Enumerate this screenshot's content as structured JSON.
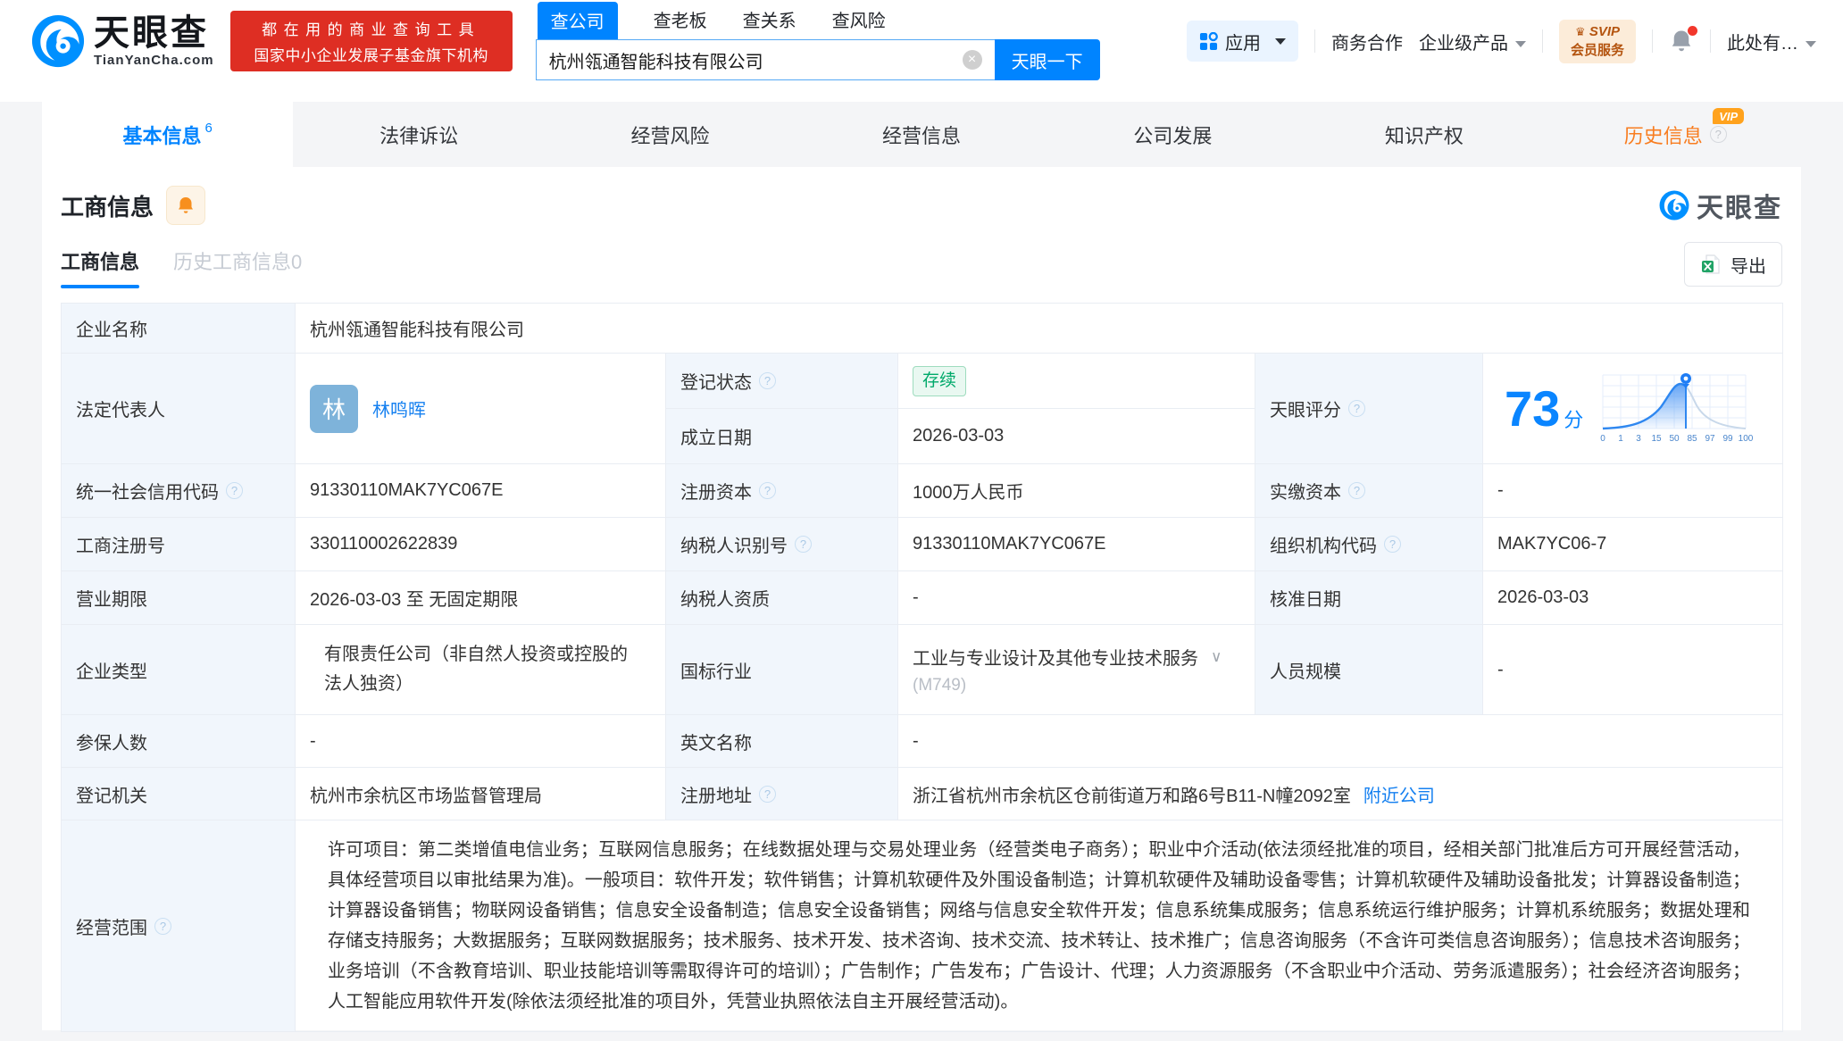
{
  "header": {
    "logo": {
      "brand": "天眼查",
      "domain": "TianYanCha.com"
    },
    "slogan_line1": "都在用的商业查询工具",
    "slogan_line2": "国家中小企业发展子基金旗下机构",
    "search_tabs": [
      {
        "label": "查公司",
        "active": true
      },
      {
        "label": "查老板",
        "active": false
      },
      {
        "label": "查关系",
        "active": false
      },
      {
        "label": "查风险",
        "active": false
      }
    ],
    "search_value": "杭州瓴通智能科技有限公司",
    "search_button": "天眼一下",
    "apps_label": "应用",
    "menu": [
      "商务合作",
      "企业级产品"
    ],
    "svip_line1": "SVIP",
    "svip_line2": "会员服务",
    "user_label": "此处有…"
  },
  "nav_tabs": [
    {
      "label": "基本信息",
      "count": "6",
      "active": true
    },
    {
      "label": "法律诉讼"
    },
    {
      "label": "经营风险"
    },
    {
      "label": "经营信息"
    },
    {
      "label": "公司发展"
    },
    {
      "label": "知识产权"
    },
    {
      "label": "历史信息",
      "vip_tag": "VIP"
    }
  ],
  "section": {
    "title": "工商信息",
    "watermark": "天眼查",
    "subtabs": [
      {
        "label": "工商信息",
        "active": true
      },
      {
        "label": "历史工商信息0",
        "active": false
      }
    ],
    "export_label": "导出"
  },
  "company": {
    "name_label": "企业名称",
    "name": "杭州瓴通智能科技有限公司",
    "legal_rep_label": "法定代表人",
    "legal_rep_avatar": "林",
    "legal_rep": "林鸣晖",
    "reg_status_label": "登记状态",
    "reg_status": "存续",
    "establish_label": "成立日期",
    "establish_date": "2026-03-03"
  },
  "score": {
    "label": "天眼评分",
    "value": "73",
    "unit": "分",
    "axis": [
      "0",
      "1",
      "3",
      "15",
      "50",
      "85",
      "97",
      "99",
      "100"
    ]
  },
  "fields": {
    "uscc": {
      "label": "统一社会信用代码",
      "value": "91330110MAK7YC067E"
    },
    "reg_capital": {
      "label": "注册资本",
      "value": "1000万人民币"
    },
    "paid_capital": {
      "label": "实缴资本",
      "value": "-"
    },
    "reg_number": {
      "label": "工商注册号",
      "value": "330110002622839"
    },
    "taxpayer_id": {
      "label": "纳税人识别号",
      "value": "91330110MAK7YC067E"
    },
    "org_code": {
      "label": "组织机构代码",
      "value": "MAK7YC06-7"
    },
    "business_term": {
      "label": "营业期限",
      "value": "2026-03-03 至 无固定期限"
    },
    "taxpayer_quality": {
      "label": "纳税人资质",
      "value": "-"
    },
    "approval_date": {
      "label": "核准日期",
      "value": "2026-03-03"
    },
    "company_type": {
      "label": "企业类型",
      "value": "有限责任公司（非自然人投资或控股的法人独资）"
    },
    "industry": {
      "label": "国标行业",
      "value": "工业与专业设计及其他专业技术服务",
      "code": "(M749)"
    },
    "staff_size": {
      "label": "人员规模",
      "value": "-"
    },
    "insured_count": {
      "label": "参保人数",
      "value": "-"
    },
    "english_name": {
      "label": "英文名称",
      "value": "-"
    },
    "reg_authority": {
      "label": "登记机关",
      "value": "杭州市余杭区市场监督管理局"
    },
    "reg_address": {
      "label": "注册地址",
      "value": "浙江省杭州市余杭区仓前街道万和路6号B11-N幢2092室",
      "link": "附近公司"
    },
    "business_scope": {
      "label": "经营范围",
      "value": "许可项目：第二类增值电信业务；互联网信息服务；在线数据处理与交易处理业务（经营类电子商务）；职业中介活动(依法须经批准的项目，经相关部门批准后方可开展经营活动，具体经营项目以审批结果为准)。一般项目：软件开发；软件销售；计算机软硬件及外围设备制造；计算机软硬件及辅助设备零售；计算机软硬件及辅助设备批发；计算器设备制造；计算器设备销售；物联网设备销售；信息安全设备制造；信息安全设备销售；网络与信息安全软件开发；信息系统集成服务；信息系统运行维护服务；计算机系统服务；数据处理和存储支持服务；大数据服务；互联网数据服务；技术服务、技术开发、技术咨询、技术交流、技术转让、技术推广；信息咨询服务（不含许可类信息咨询服务）；信息技术咨询服务；业务培训（不含教育培训、职业技能培训等需取得许可的培训）；广告制作；广告发布；广告设计、代理；人力资源服务（不含职业中介活动、劳务派遣服务）；社会经济咨询服务；人工智能应用软件开发(除依法须经批准的项目外，凭营业执照依法自主开展经营活动)。"
    }
  }
}
